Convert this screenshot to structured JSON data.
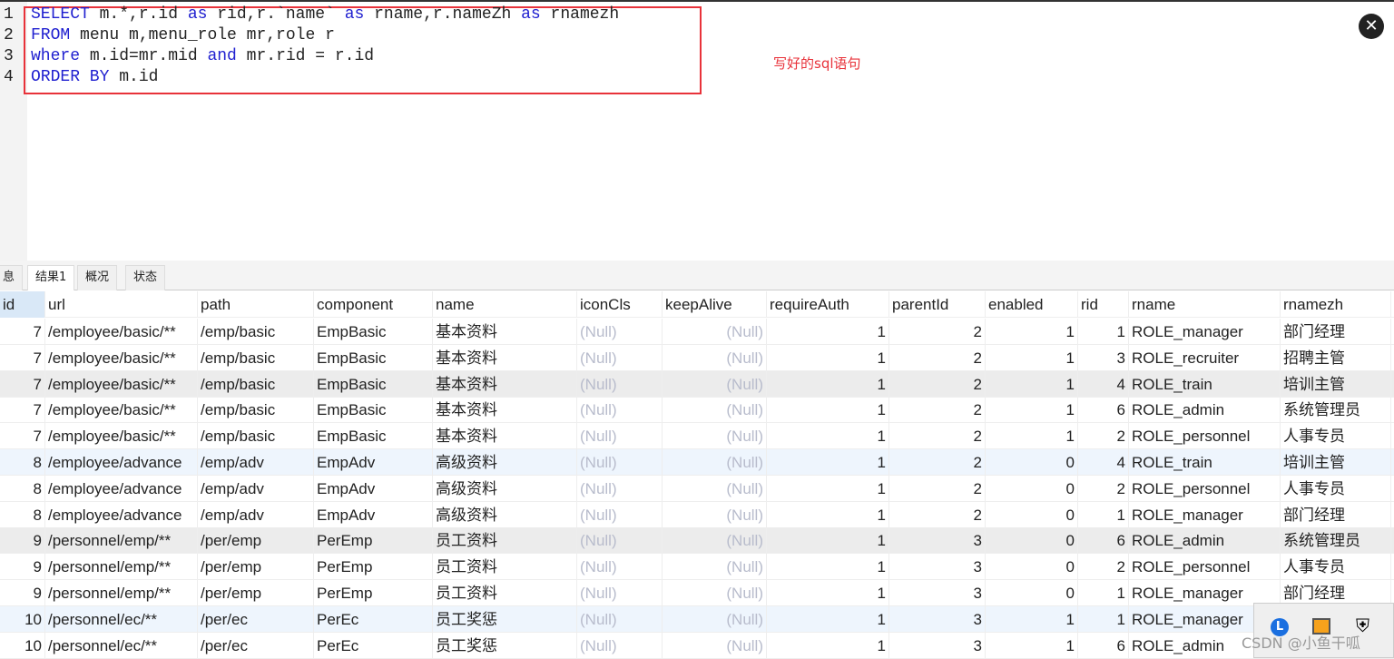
{
  "editor": {
    "lines": [
      [
        [
          "kw",
          "SELECT"
        ],
        [
          "t",
          " m.*,r.id "
        ],
        [
          "kw",
          "as"
        ],
        [
          "t",
          " rid,r.`name` "
        ],
        [
          "kw",
          "as"
        ],
        [
          "t",
          " rname,r.nameZh "
        ],
        [
          "kw",
          "as"
        ],
        [
          "t",
          " rnamezh"
        ]
      ],
      [
        [
          "kw",
          "FROM"
        ],
        [
          "t",
          " menu m,menu_role mr,role r"
        ]
      ],
      [
        [
          "kw",
          "where"
        ],
        [
          "t",
          " m.id=mr.mid "
        ],
        [
          "kw",
          "and"
        ],
        [
          "t",
          " mr.rid = r.id"
        ]
      ],
      [
        [
          "kw",
          "ORDER BY"
        ],
        [
          "t",
          " m.id"
        ]
      ]
    ],
    "line_numbers": [
      "1",
      "2",
      "3",
      "4"
    ],
    "annotation": "写好的sql语句",
    "annotation_color": "#e8323a"
  },
  "close_icon": "close-icon",
  "tabs": [
    {
      "label": "息"
    },
    {
      "label": "结果1",
      "active": true
    },
    {
      "label": "概况"
    },
    {
      "label": "状态"
    }
  ],
  "grid": {
    "columns": [
      "id",
      "url",
      "path",
      "component",
      "name",
      "iconCls",
      "keepAlive",
      "requireAuth",
      "parentId",
      "enabled",
      "rid",
      "rname",
      "rnamezh"
    ],
    "rows": [
      [
        "7",
        "/employee/basic/**",
        "/emp/basic",
        "EmpBasic",
        "基本资料",
        "(Null)",
        "(Null)",
        "1",
        "2",
        "1",
        "1",
        "ROLE_manager",
        "部门经理"
      ],
      [
        "7",
        "/employee/basic/**",
        "/emp/basic",
        "EmpBasic",
        "基本资料",
        "(Null)",
        "(Null)",
        "1",
        "2",
        "1",
        "3",
        "ROLE_recruiter",
        "招聘主管"
      ],
      [
        "7",
        "/employee/basic/**",
        "/emp/basic",
        "EmpBasic",
        "基本资料",
        "(Null)",
        "(Null)",
        "1",
        "2",
        "1",
        "4",
        "ROLE_train",
        "培训主管"
      ],
      [
        "7",
        "/employee/basic/**",
        "/emp/basic",
        "EmpBasic",
        "基本资料",
        "(Null)",
        "(Null)",
        "1",
        "2",
        "1",
        "6",
        "ROLE_admin",
        "系统管理员"
      ],
      [
        "7",
        "/employee/basic/**",
        "/emp/basic",
        "EmpBasic",
        "基本资料",
        "(Null)",
        "(Null)",
        "1",
        "2",
        "1",
        "2",
        "ROLE_personnel",
        "人事专员"
      ],
      [
        "8",
        "/employee/advance",
        "/emp/adv",
        "EmpAdv",
        "高级资料",
        "(Null)",
        "(Null)",
        "1",
        "2",
        "0",
        "4",
        "ROLE_train",
        "培训主管"
      ],
      [
        "8",
        "/employee/advance",
        "/emp/adv",
        "EmpAdv",
        "高级资料",
        "(Null)",
        "(Null)",
        "1",
        "2",
        "0",
        "2",
        "ROLE_personnel",
        "人事专员"
      ],
      [
        "8",
        "/employee/advance",
        "/emp/adv",
        "EmpAdv",
        "高级资料",
        "(Null)",
        "(Null)",
        "1",
        "2",
        "0",
        "1",
        "ROLE_manager",
        "部门经理"
      ],
      [
        "9",
        "/personnel/emp/**",
        "/per/emp",
        "PerEmp",
        "员工资料",
        "(Null)",
        "(Null)",
        "1",
        "3",
        "0",
        "6",
        "ROLE_admin",
        "系统管理员"
      ],
      [
        "9",
        "/personnel/emp/**",
        "/per/emp",
        "PerEmp",
        "员工资料",
        "(Null)",
        "(Null)",
        "1",
        "3",
        "0",
        "2",
        "ROLE_personnel",
        "人事专员"
      ],
      [
        "9",
        "/personnel/emp/**",
        "/per/emp",
        "PerEmp",
        "员工资料",
        "(Null)",
        "(Null)",
        "1",
        "3",
        "0",
        "1",
        "ROLE_manager",
        "部门经理"
      ],
      [
        "10",
        "/personnel/ec/**",
        "/per/ec",
        "PerEc",
        "员工奖惩",
        "(Null)",
        "(Null)",
        "1",
        "3",
        "1",
        "1",
        "ROLE_manager",
        ""
      ],
      [
        "10",
        "/personnel/ec/**",
        "/per/ec",
        "PerEc",
        "员工奖惩",
        "(Null)",
        "(Null)",
        "1",
        "3",
        "1",
        "6",
        "ROLE_admin",
        ""
      ]
    ],
    "row_highlight": {
      "gray": "#ececec",
      "blue": "#eef5fd"
    }
  },
  "tray_icons": [
    "app-l-icon",
    "window-icon",
    "shield-warning-icon"
  ],
  "watermark": "CSDN @小鱼干呱"
}
